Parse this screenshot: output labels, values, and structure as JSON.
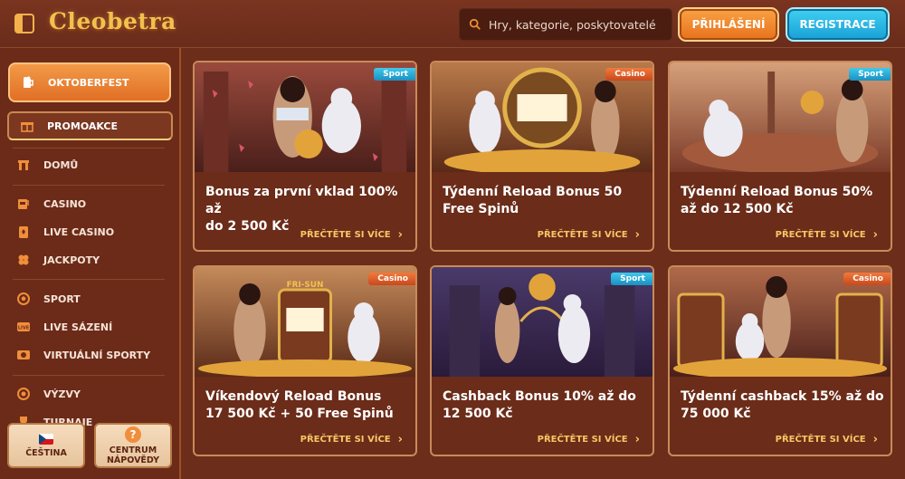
{
  "header": {
    "logo_text": "Cleobetra",
    "search_placeholder": "Hry, kategorie, poskytovatelé",
    "login_label": "PŘIHLÁŠENÍ",
    "register_label": "REGISTRACE"
  },
  "sidebar": {
    "featured": "OKTOBERFEST",
    "promo": "PROMOAKCE",
    "items": [
      {
        "label": "DOMŮ",
        "icon": "home-icon"
      },
      {
        "label": "CASINO",
        "icon": "slot-machine-icon"
      },
      {
        "label": "LIVE CASINO",
        "icon": "card-icon"
      },
      {
        "label": "JACKPOTY",
        "icon": "clover-icon"
      },
      {
        "label": "SPORT",
        "icon": "soccer-ball-icon"
      },
      {
        "label": "LIVE SÁZENÍ",
        "icon": "live-icon"
      },
      {
        "label": "VIRTUÁLNÍ SPORTY",
        "icon": "virtual-icon"
      },
      {
        "label": "VÝZVY",
        "icon": "target-icon"
      },
      {
        "label": "TURNAJE",
        "icon": "trophy-icon"
      }
    ],
    "language_label": "ČEŠTINA",
    "help_label_1": "CENTRUM",
    "help_label_2": "NÁPOVĚDY"
  },
  "promos": [
    {
      "title_1": "Bonus za první vklad 100% až",
      "title_2": "do 2 500 Kč",
      "tag": "Sport",
      "more": "PŘEČTĚTE SI VÍCE"
    },
    {
      "title_1": "Týdenní Reload Bonus 50",
      "title_2": "Free Spinů",
      "tag": "Casino",
      "more": "PŘEČTĚTE SI VÍCE"
    },
    {
      "title_1": "Týdenní Reload Bonus 50%",
      "title_2": "až do 12 500 Kč",
      "tag": "Sport",
      "more": "PŘEČTĚTE SI VÍCE"
    },
    {
      "title_1": "Víkendový Reload Bonus",
      "title_2": "17 500 Kč + 50 Free Spinů",
      "tag": "Casino",
      "more": "PŘEČTĚTE SI VÍCE"
    },
    {
      "title_1": "Cashback Bonus 10% až do",
      "title_2": "12 500 Kč",
      "tag": "Sport",
      "more": "PŘEČTĚTE SI VÍCE"
    },
    {
      "title_1": "Týdenní cashback 15% až do",
      "title_2": "75 000 Kč",
      "tag": "Casino",
      "more": "PŘEČTĚTE SI VÍCE"
    }
  ],
  "colors": {
    "accent_orange": "#f08e3b",
    "accent_blue": "#1fa6da",
    "background": "#6c2d1a",
    "link_gold": "#f6c766"
  }
}
